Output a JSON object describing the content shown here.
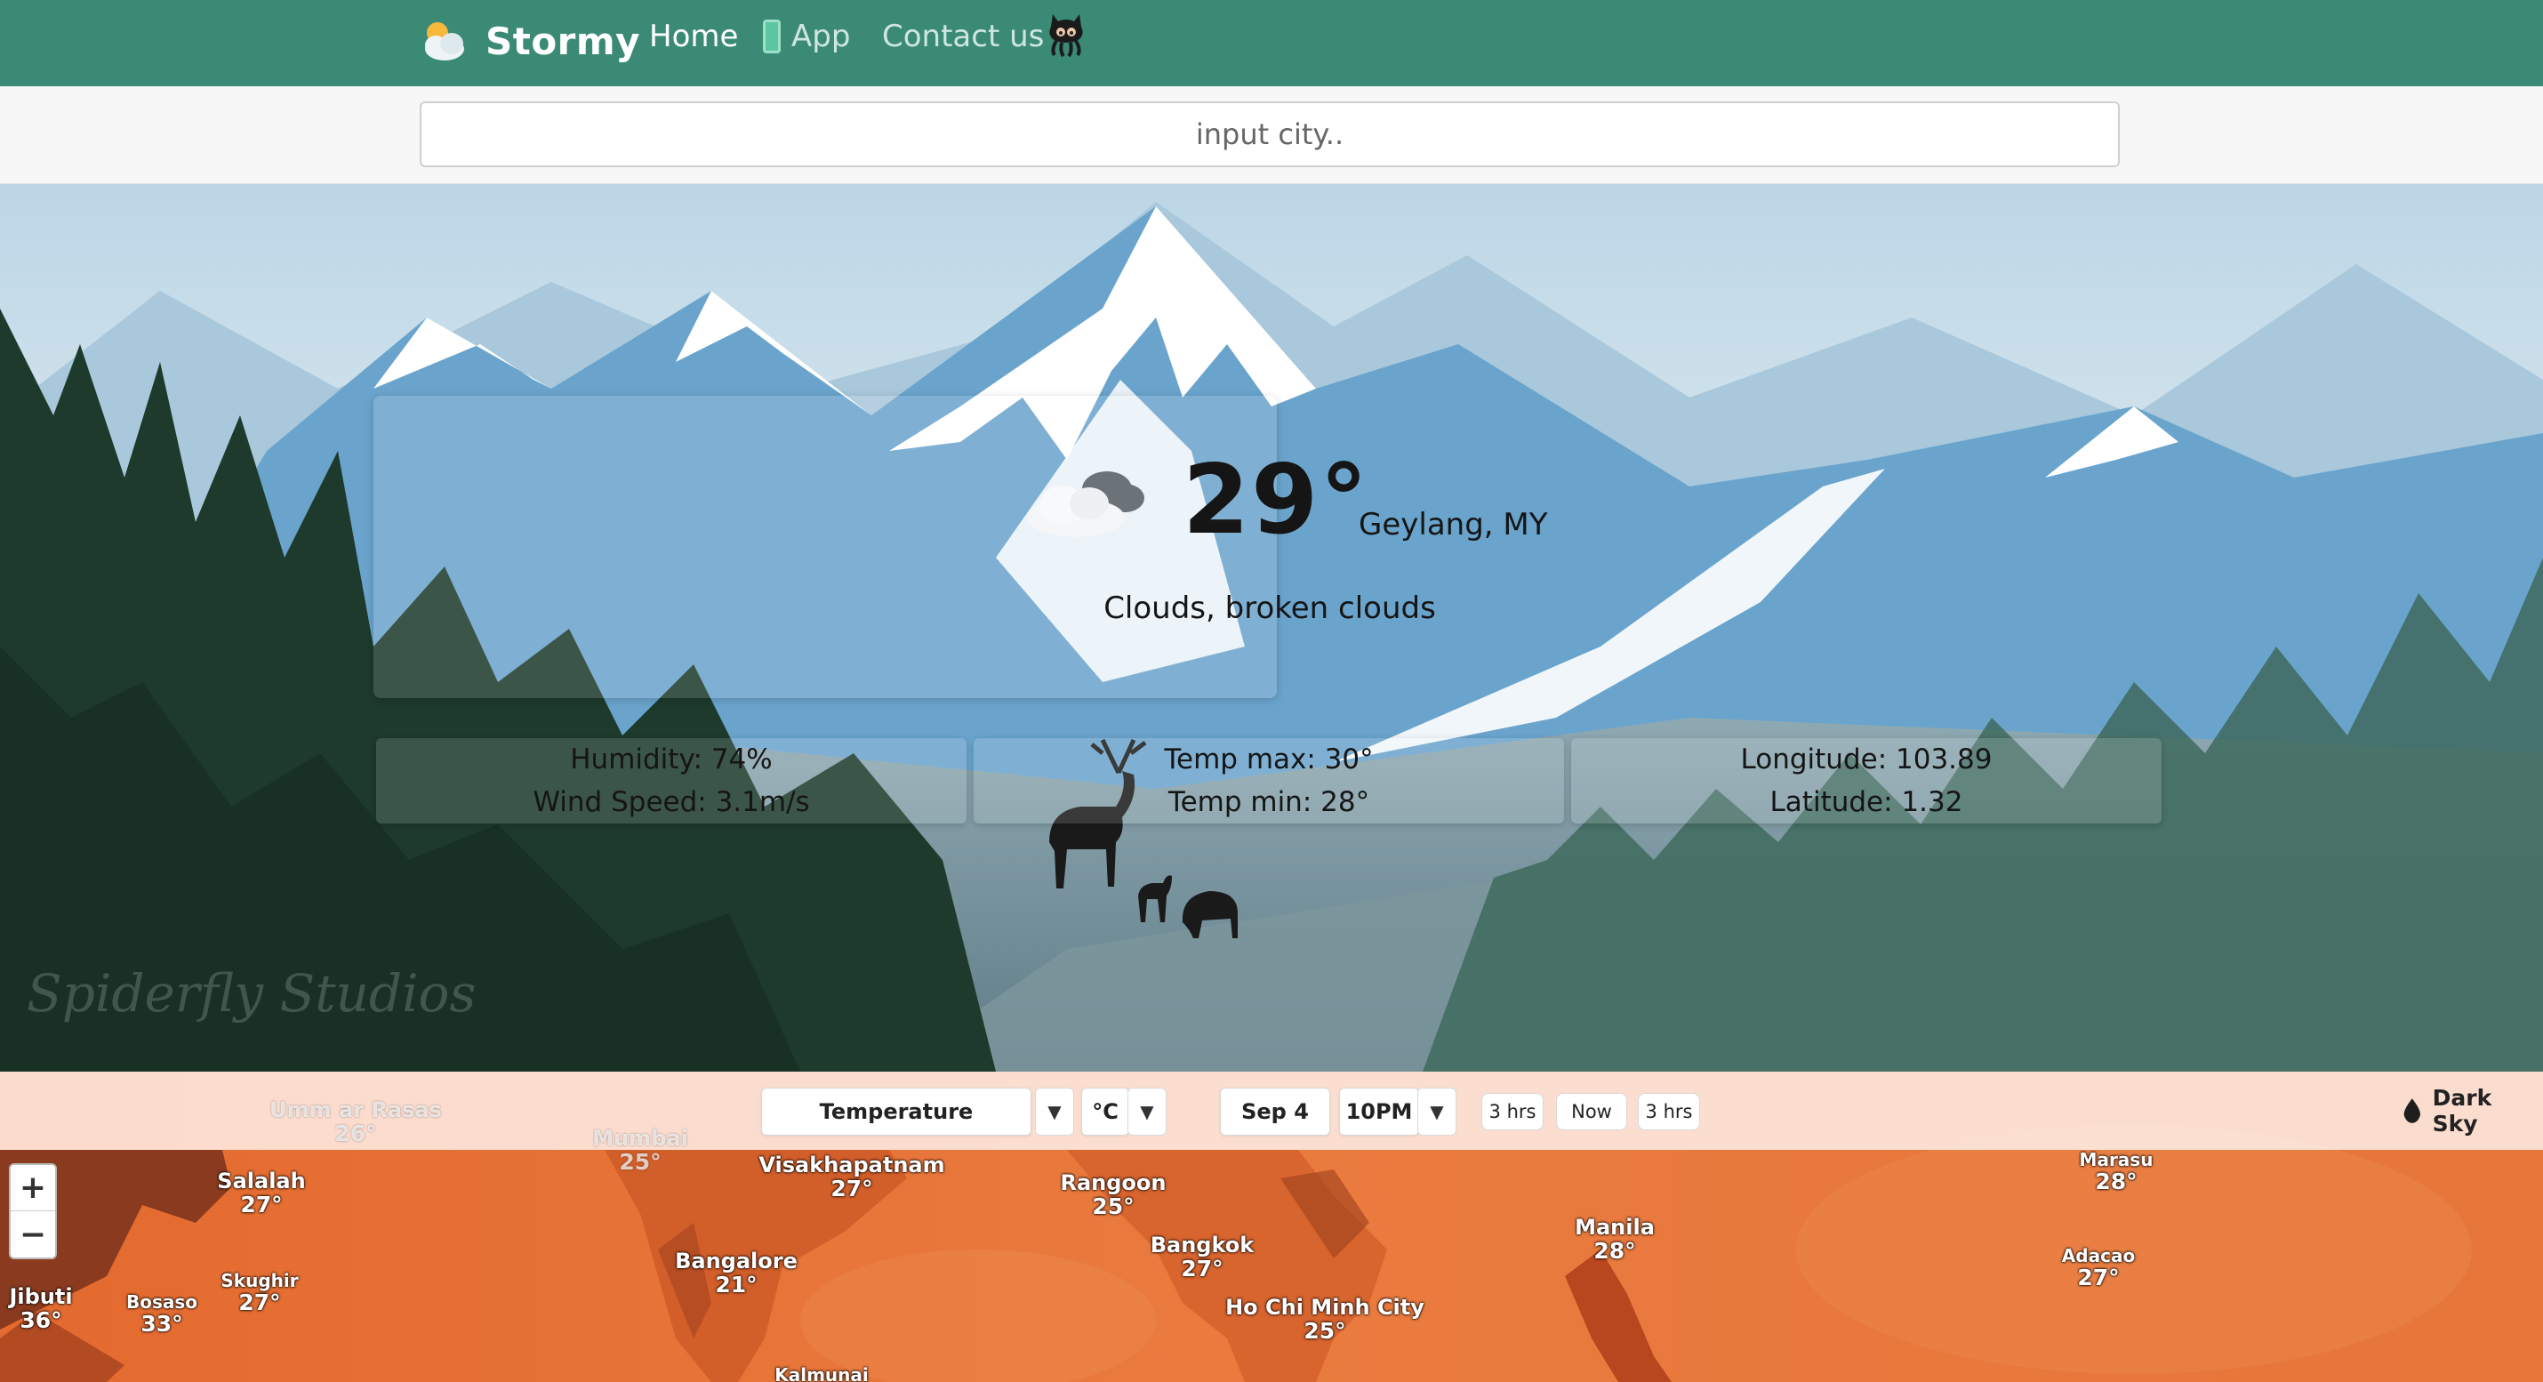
{
  "nav": {
    "brand": "Stormy",
    "home": "Home",
    "app": "App",
    "contact": "Contact us",
    "brand_icon": "sun-cloud-icon",
    "app_icon": "phone-icon",
    "github_icon": "github-octocat-icon"
  },
  "search": {
    "placeholder": "input city.."
  },
  "weather": {
    "temp": "29°",
    "location": "Geylang, MY",
    "description": "Clouds, broken clouds",
    "icon": "broken-clouds-icon",
    "humidity": "Humidity: 74%",
    "wind": "Wind Speed: 3.1m/s",
    "temp_max": "Temp max: 30°",
    "temp_min": "Temp min: 28°",
    "longitude": "Longitude: 103.89",
    "latitude": "Latitude: 1.32"
  },
  "hero": {
    "watermark": "Spiderfly Studios"
  },
  "map": {
    "layer": "Temperature",
    "unit": "°C",
    "date": "Sep 4",
    "time": "10PM",
    "step_back": "3 hrs",
    "now": "Now",
    "step_forward": "3 hrs",
    "provider": "Dark Sky",
    "zoom_in": "+",
    "zoom_out": "−",
    "cities": [
      {
        "name": "Umm ar Rasas",
        "temp": "26°"
      },
      {
        "name": "Mumbai",
        "temp": "25°"
      },
      {
        "name": "Salalah",
        "temp": "27°"
      },
      {
        "name": "Visakhapatnam",
        "temp": "27°"
      },
      {
        "name": "Rangoon",
        "temp": "25°"
      },
      {
        "name": "Bangalore",
        "temp": "21°"
      },
      {
        "name": "Bangkok",
        "temp": "27°"
      },
      {
        "name": "Ho Chi Minh City",
        "temp": "25°"
      },
      {
        "name": "Manila",
        "temp": "28°"
      },
      {
        "name": "Marasu",
        "temp": "28°"
      },
      {
        "name": "Adacao",
        "temp": "27°"
      },
      {
        "name": "Skughir",
        "temp": "27°"
      },
      {
        "name": "Jibuti",
        "temp": "36°"
      },
      {
        "name": "Bosaso",
        "temp": "33°"
      },
      {
        "name": "Kalmunai",
        "temp": ""
      }
    ],
    "colors": {
      "hot": "#e3723c",
      "warm": "#f09a6b",
      "land_dark": "#7a2f1a"
    }
  },
  "colors": {
    "navbar": "#3b8a76",
    "accent": "#5cc6a4"
  }
}
